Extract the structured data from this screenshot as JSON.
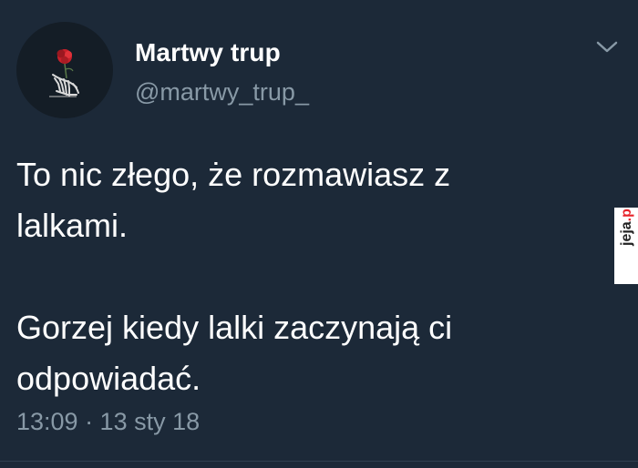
{
  "user": {
    "display_name": "Martwy trup",
    "handle": "@martwy_trup_"
  },
  "tweet": {
    "text": "To nic złego, że rozmawiasz z\nlalkami.\n\nGorzej kiedy lalki zaczynają ci\nodpowiadać.",
    "timestamp": "13:09 · 13 sty 18"
  },
  "watermark": {
    "text_main": "jeja",
    "text_suffix": ".pl",
    "color": "#e7242b"
  },
  "icons": {
    "avatar": "skeleton-hand-rose-icon",
    "menu": "chevron-down-icon"
  },
  "colors": {
    "background": "#1c2938",
    "text_primary": "#ffffff",
    "text_secondary": "#8899a6"
  }
}
